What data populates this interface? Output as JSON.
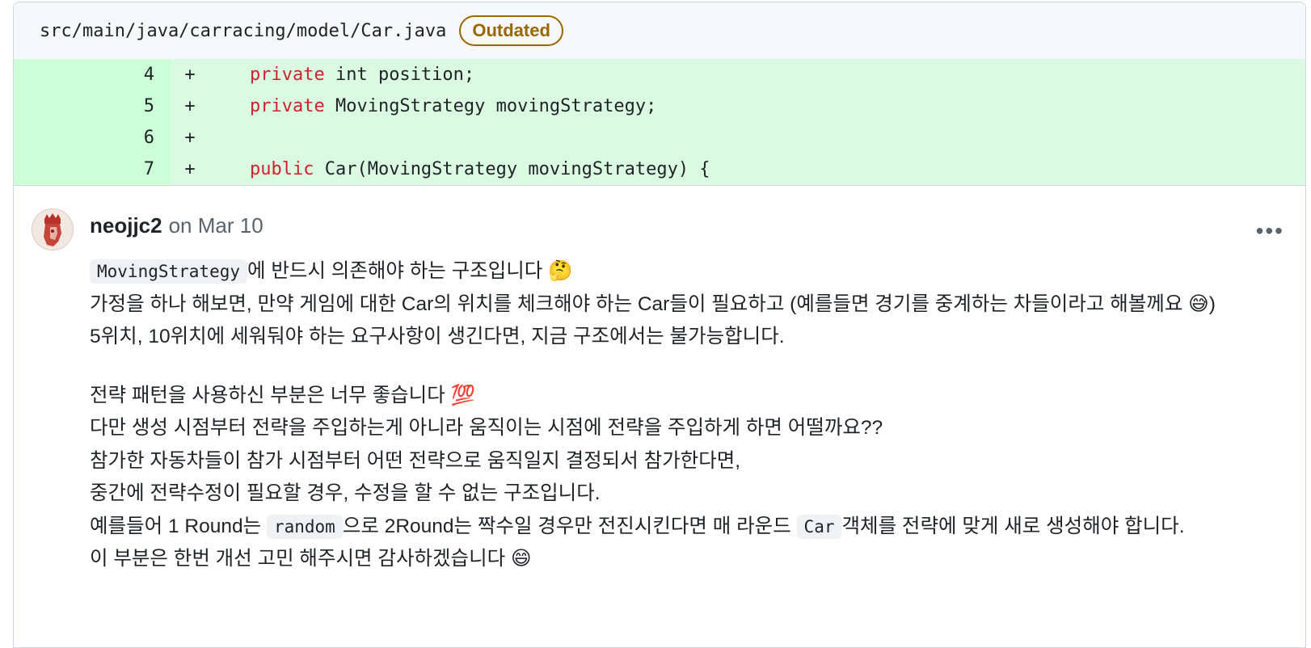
{
  "file": {
    "path": "src/main/java/carracing/model/Car.java",
    "badge": "Outdated"
  },
  "diff": [
    {
      "line": "4",
      "sign": "+",
      "keyword": "private",
      "rest": " int position;"
    },
    {
      "line": "5",
      "sign": "+",
      "keyword": "private",
      "rest": " MovingStrategy movingStrategy;"
    },
    {
      "line": "6",
      "sign": "+",
      "keyword": "",
      "rest": ""
    },
    {
      "line": "7",
      "sign": "+",
      "keyword": "public",
      "rest": " Car(MovingStrategy movingStrategy) {"
    }
  ],
  "comment": {
    "author": "neojjc2",
    "date": "on Mar 10",
    "more_icon": "•••",
    "p1_code": "MovingStrategy",
    "p1_text": "에 반드시 의존해야 하는 구조입니다 🤔",
    "p2": "가정을 하나 해보면, 만약 게임에 대한 Car의 위치를 체크해야 하는 Car들이 필요하고 (예를들면 경기를 중계하는 차들이라고 해볼께요 😅) 5위치, 10위치에 세워둬야 하는 요구사항이 생긴다면, 지금 구조에서는 불가능합니다.",
    "p3": "전략 패턴을 사용하신 부분은 너무 좋습니다 💯",
    "p4": "다만 생성 시점부터 전략을 주입하는게 아니라 움직이는 시점에 전략을 주입하게 하면 어떨까요??",
    "p5": "참가한 자동차들이 참가 시점부터 어떤 전략으로 움직일지 결정되서 참가한다면,",
    "p6": "중간에 전략수정이 필요할 경우, 수정을 할 수 없는 구조입니다.",
    "p7_a": "예를들어 1 Round는 ",
    "p7_code1": "random",
    "p7_b": "으로 2Round는 짝수일 경우만 전진시킨다면 매 라운드 ",
    "p7_code2": "Car",
    "p7_c": "객체를 전략에 맞게 새로 생성해야 합니다.",
    "p8": "이 부분은 한번 개선 고민 해주시면 감사하겠습니다 😄"
  }
}
